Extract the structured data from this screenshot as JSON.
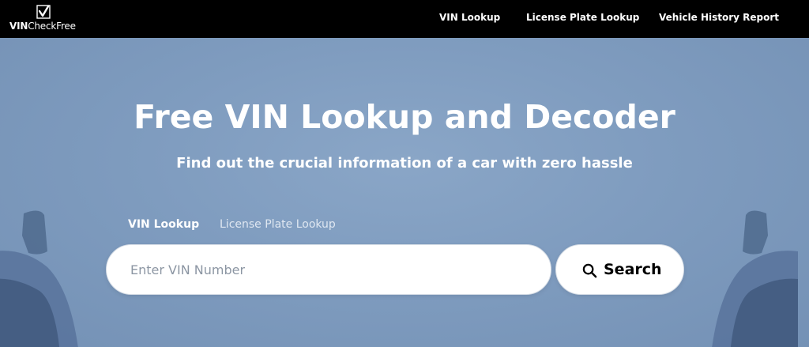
{
  "header": {
    "logo_bold": "VIN",
    "logo_rest": "CheckFree",
    "nav": [
      {
        "label": "VIN Lookup"
      },
      {
        "label": "License Plate Lookup"
      },
      {
        "label": "Vehicle History Report"
      }
    ]
  },
  "hero": {
    "title": "Free VIN Lookup and Decoder",
    "subtitle": "Find out the crucial information of a car with zero hassle",
    "tabs": [
      {
        "label": "VIN Lookup",
        "active": true
      },
      {
        "label": "License Plate Lookup",
        "active": false
      }
    ],
    "search": {
      "placeholder": "Enter VIN Number",
      "value": "",
      "button_label": "Search",
      "icon": "search-icon"
    }
  },
  "colors": {
    "nav_bg": "#000000",
    "hero_bg": "#7f9cbf",
    "text_light": "#ffffff"
  }
}
